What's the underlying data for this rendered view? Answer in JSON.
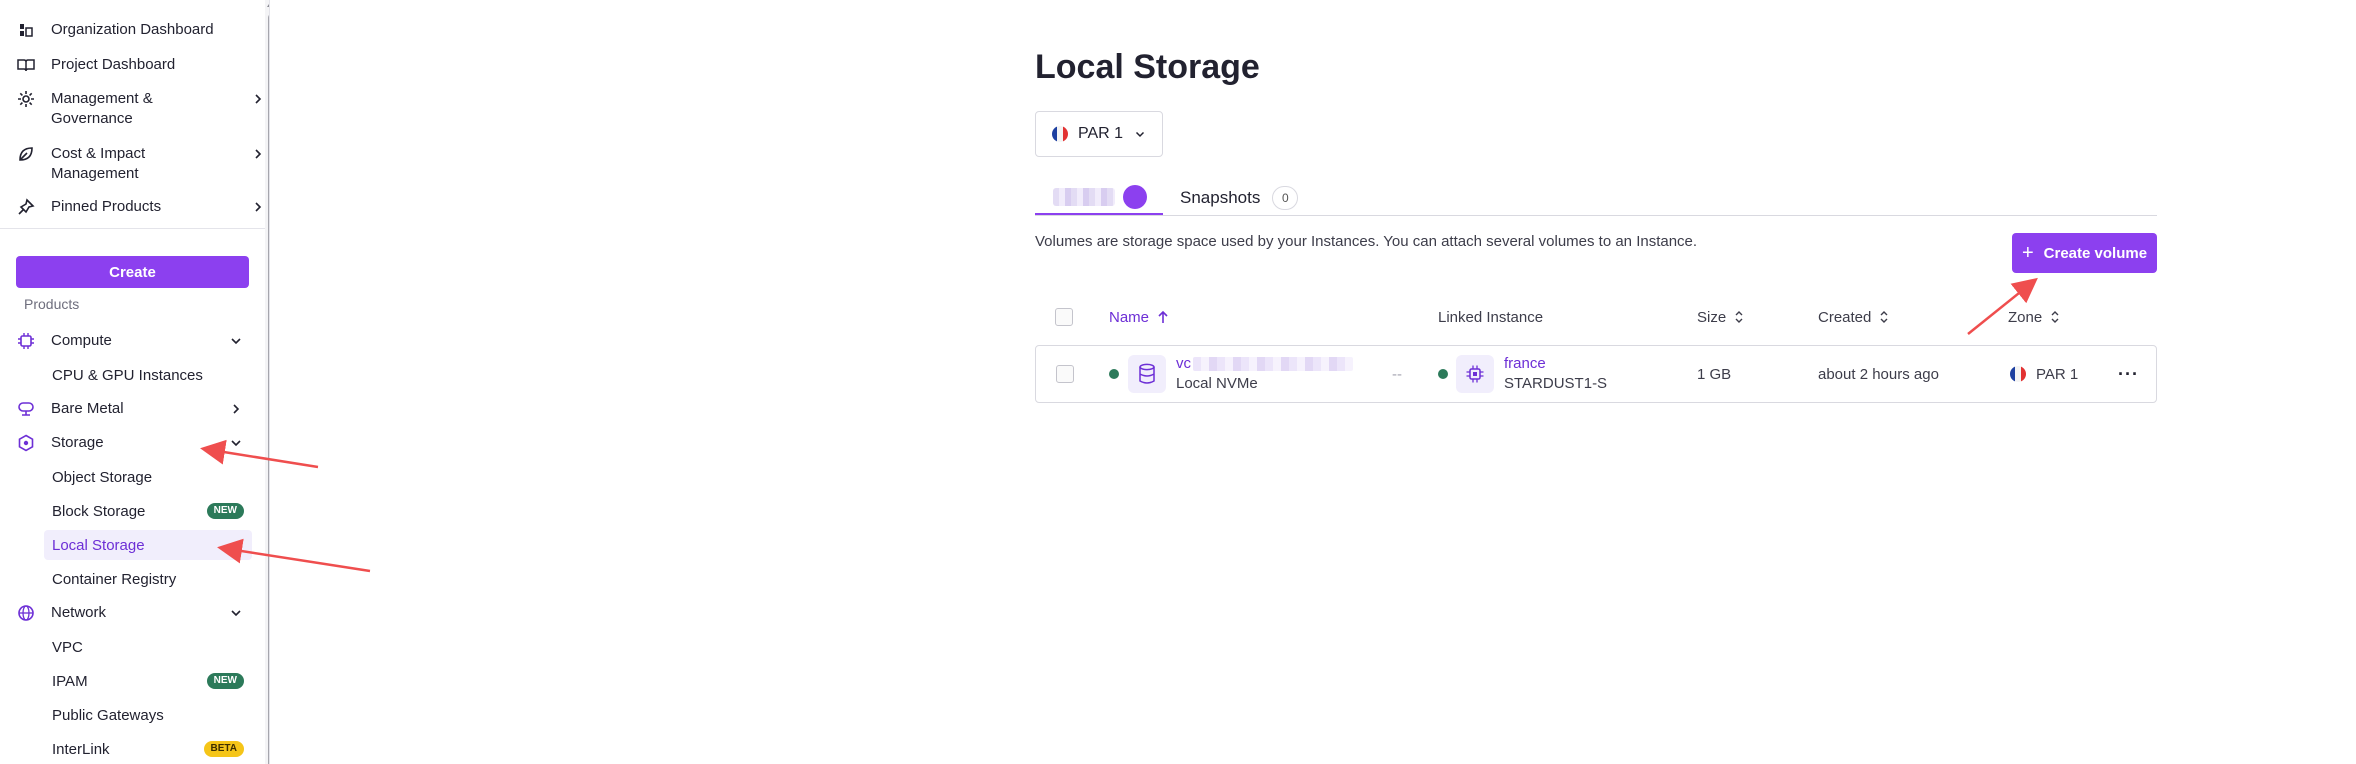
{
  "sidebar": {
    "top_items": [
      {
        "label": "Organization Dashboard",
        "icon": "organization-icon"
      },
      {
        "label": "Project Dashboard",
        "icon": "book-icon"
      },
      {
        "label": "Management & Governance",
        "icon": "gear-icon"
      },
      {
        "label": "Cost & Impact Management",
        "icon": "leaf-icon"
      },
      {
        "label": "Pinned Products",
        "icon": "pin-icon"
      }
    ],
    "create_label": "Create",
    "products_label": "Products",
    "categories": [
      {
        "label": "Compute",
        "icon": "chip-icon",
        "expanded": true
      },
      {
        "label": "Bare Metal",
        "icon": "server-icon",
        "expanded": false
      },
      {
        "label": "Storage",
        "icon": "hexagon-icon",
        "expanded": true
      },
      {
        "label": "Network",
        "icon": "globe-icon",
        "expanded": true
      }
    ],
    "sub_items": {
      "cpu_gpu": "CPU & GPU Instances",
      "object_storage": "Object Storage",
      "block_storage": "Block Storage",
      "local_storage": "Local Storage",
      "container_registry": "Container Registry",
      "vpc": "VPC",
      "ipam": "IPAM",
      "public_gateways": "Public Gateways",
      "interlink": "InterLink"
    },
    "badges": {
      "new": "NEW",
      "beta": "BETA"
    }
  },
  "main": {
    "title": "Local Storage",
    "zone_selector": {
      "value": "PAR 1"
    },
    "tabs": {
      "snapshots_label": "Snapshots",
      "snapshots_count": "0"
    },
    "description": "Volumes are storage space used by your Instances. You can attach several volumes to an Instance.",
    "create_volume_label": "Create volume",
    "table": {
      "columns": {
        "name": "Name",
        "linked_instance": "Linked Instance",
        "size": "Size",
        "created": "Created",
        "zone": "Zone"
      },
      "rows": [
        {
          "name_prefix": "vc",
          "type": "Local NVMe",
          "separator": "--",
          "instance_name": "france",
          "instance_type": "STARDUST1-S",
          "size": "1 GB",
          "created": "about 2 hours ago",
          "zone": "PAR 1",
          "actions": "···"
        }
      ]
    }
  },
  "colors": {
    "accent": "#8c40ef",
    "accent_text": "#6d2fd6",
    "status_ok": "#2c7a5a",
    "annotation": "#ef4e4e"
  }
}
